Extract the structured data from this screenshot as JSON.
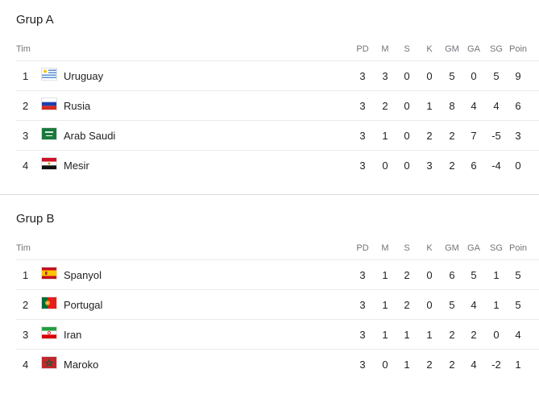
{
  "columns": {
    "team": "Tim",
    "played": "PD",
    "won": "M",
    "drawn": "S",
    "lost": "K",
    "goals_for": "GM",
    "goals_against": "GA",
    "goal_diff": "SG",
    "points": "Poin"
  },
  "groups": [
    {
      "title": "Grup A",
      "teams": [
        {
          "rank": "1",
          "name": "Uruguay",
          "flag_icon": "uruguay-flag-icon",
          "played": "3",
          "won": "3",
          "drawn": "0",
          "lost": "0",
          "gf": "5",
          "ga": "0",
          "gd": "5",
          "pts": "9"
        },
        {
          "rank": "2",
          "name": "Rusia",
          "flag_icon": "russia-flag-icon",
          "played": "3",
          "won": "2",
          "drawn": "0",
          "lost": "1",
          "gf": "8",
          "ga": "4",
          "gd": "4",
          "pts": "6"
        },
        {
          "rank": "3",
          "name": "Arab Saudi",
          "flag_icon": "saudi-arabia-flag-icon",
          "played": "3",
          "won": "1",
          "drawn": "0",
          "lost": "2",
          "gf": "2",
          "ga": "7",
          "gd": "-5",
          "pts": "3"
        },
        {
          "rank": "4",
          "name": "Mesir",
          "flag_icon": "egypt-flag-icon",
          "played": "3",
          "won": "0",
          "drawn": "0",
          "lost": "3",
          "gf": "2",
          "ga": "6",
          "gd": "-4",
          "pts": "0"
        }
      ]
    },
    {
      "title": "Grup B",
      "teams": [
        {
          "rank": "1",
          "name": "Spanyol",
          "flag_icon": "spain-flag-icon",
          "played": "3",
          "won": "1",
          "drawn": "2",
          "lost": "0",
          "gf": "6",
          "ga": "5",
          "gd": "1",
          "pts": "5"
        },
        {
          "rank": "2",
          "name": "Portugal",
          "flag_icon": "portugal-flag-icon",
          "played": "3",
          "won": "1",
          "drawn": "2",
          "lost": "0",
          "gf": "5",
          "ga": "4",
          "gd": "1",
          "pts": "5"
        },
        {
          "rank": "3",
          "name": "Iran",
          "flag_icon": "iran-flag-icon",
          "played": "3",
          "won": "1",
          "drawn": "1",
          "lost": "1",
          "gf": "2",
          "ga": "2",
          "gd": "0",
          "pts": "4"
        },
        {
          "rank": "4",
          "name": "Maroko",
          "flag_icon": "morocco-flag-icon",
          "played": "3",
          "won": "0",
          "drawn": "1",
          "lost": "2",
          "gf": "2",
          "ga": "4",
          "gd": "-2",
          "pts": "1"
        }
      ]
    }
  ],
  "colors": {
    "text": "#222222",
    "header_text": "#70757a",
    "row_border": "#e8eaed"
  }
}
